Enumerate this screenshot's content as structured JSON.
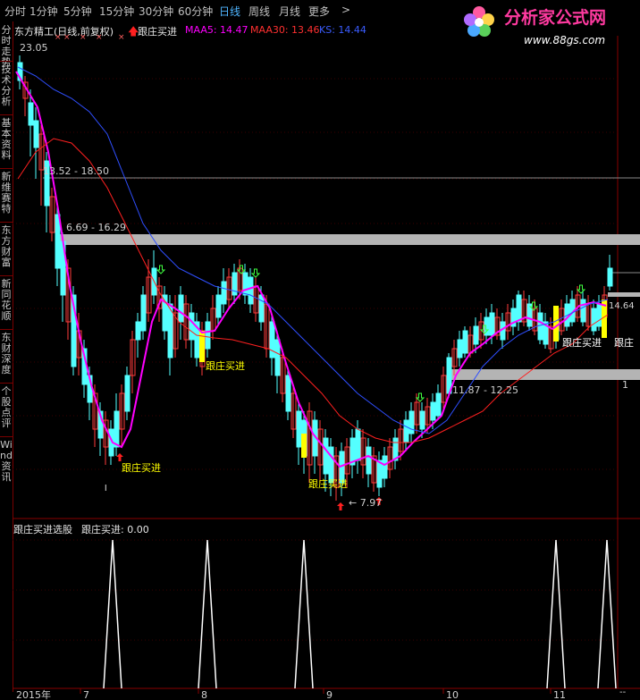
{
  "toolbar": {
    "periods": [
      "分时",
      "1分钟",
      "5分钟",
      "15分钟",
      "30分钟",
      "60分钟",
      "日线",
      "周线",
      "月线",
      "更多"
    ],
    "active": "日线",
    "more_arrow": ">"
  },
  "logo": {
    "title": "分析家公式网",
    "url": "www.88gs.com"
  },
  "sidebar": {
    "tabs": [
      "分时走势",
      "技术分析",
      "基本资料",
      "新维赛特",
      "东方财富",
      "新同花顺",
      "东财深度",
      "个股点评",
      "Wind资讯"
    ]
  },
  "main_header": {
    "stock": "东方精工(日线,前复权)",
    "formula": "跟庄买进",
    "ma5": "MAA5: 14.47",
    "ma30": "MAA30: 13.46",
    "ks": "KS: 14.44"
  },
  "sub_header": {
    "formula": "跟庄买进选股",
    "value": "跟庄买进: 0.00"
  },
  "price_labels": {
    "high": "23.05",
    "low": "7.97",
    "last": "14.64",
    "zone1": "13.52 - 18.50",
    "zone2": "6.69 - 16.29",
    "zone3": "11.87 - 12.25"
  },
  "signal_labels": [
    "跟庄买进",
    "跟庄买进",
    "跟庄买进",
    "跟庄买进",
    "跟庄买进",
    "跟庄"
  ],
  "date_axis": {
    "year": "2015年",
    "months": [
      "7",
      "8",
      "9",
      "10",
      "11"
    ]
  },
  "right_marks": {
    "main": "1",
    "sub": "--"
  },
  "colors": {
    "up": "#ff3c3c",
    "down": "#54ffff",
    "ma5": "#ff00ff",
    "ma30": "#ff2020",
    "ks": "#2f4fff",
    "signal": "#ffff00",
    "zone": "#b4b4b4",
    "active_tab": "#4fb5ff"
  }
}
